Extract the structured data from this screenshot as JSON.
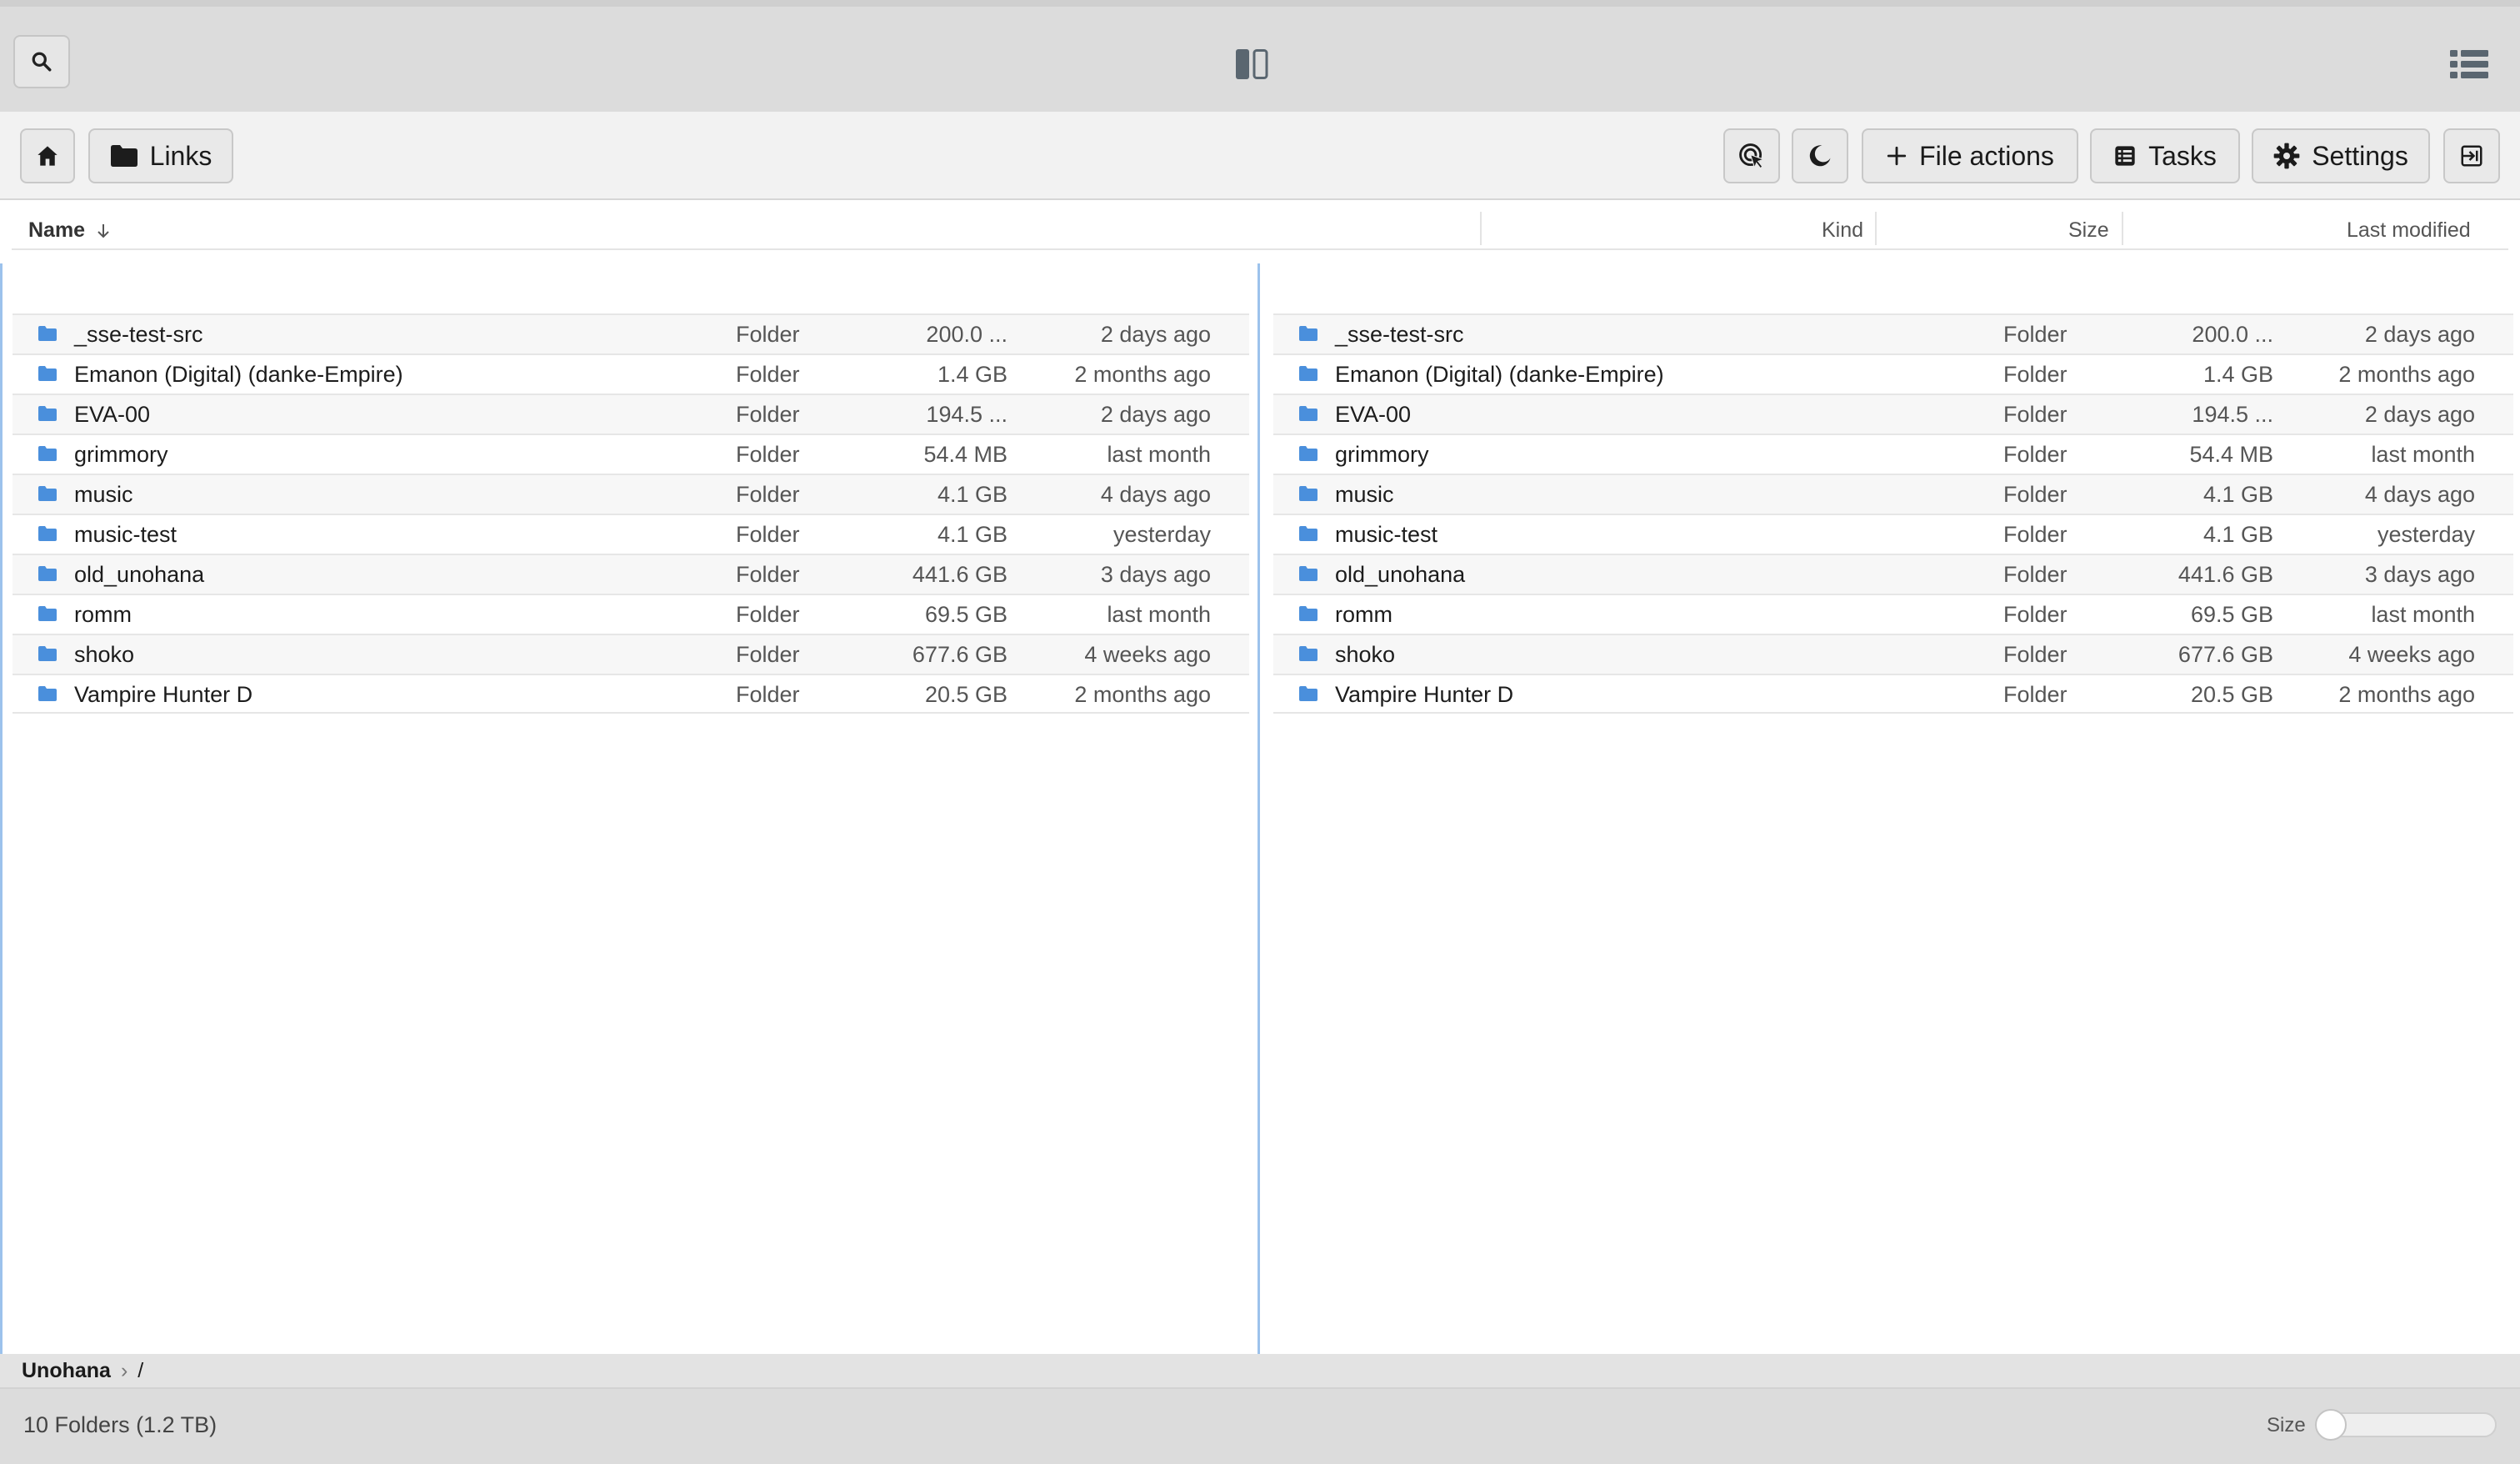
{
  "toolbar": {
    "links_label": "Links",
    "file_actions_label": "File actions",
    "tasks_label": "Tasks",
    "settings_label": "Settings"
  },
  "columns": {
    "name": "Name",
    "kind": "Kind",
    "size": "Size",
    "modified": "Last modified"
  },
  "files": [
    {
      "name": "_sse-test-src",
      "kind": "Folder",
      "size": "200.0 ...",
      "modified": "2 days ago"
    },
    {
      "name": "Emanon (Digital) (danke-Empire)",
      "kind": "Folder",
      "size": "1.4 GB",
      "modified": "2 months ago"
    },
    {
      "name": "EVA-00",
      "kind": "Folder",
      "size": "194.5 ...",
      "modified": "2 days ago"
    },
    {
      "name": "grimmory",
      "kind": "Folder",
      "size": "54.4 MB",
      "modified": "last month"
    },
    {
      "name": "music",
      "kind": "Folder",
      "size": "4.1 GB",
      "modified": "4 days ago"
    },
    {
      "name": "music-test",
      "kind": "Folder",
      "size": "4.1 GB",
      "modified": "yesterday"
    },
    {
      "name": "old_unohana",
      "kind": "Folder",
      "size": "441.6 GB",
      "modified": "3 days ago"
    },
    {
      "name": "romm",
      "kind": "Folder",
      "size": "69.5 GB",
      "modified": "last month"
    },
    {
      "name": "shoko",
      "kind": "Folder",
      "size": "677.6 GB",
      "modified": "4 weeks ago"
    },
    {
      "name": "Vampire Hunter D",
      "kind": "Folder",
      "size": "20.5 GB",
      "modified": "2 months ago"
    }
  ],
  "breadcrumb": {
    "root": "Unohana",
    "separator": "›",
    "path": "/"
  },
  "status": {
    "summary": "10 Folders (1.2 TB)",
    "size_label": "Size",
    "size_slider_value": 0
  },
  "colors": {
    "folder": "#4a8fdc",
    "pane_divider": "#9cc2ec"
  },
  "icons": [
    "search-icon",
    "split-view-icon",
    "list-view-icon",
    "home-icon",
    "folder-icon",
    "cursor-click-icon",
    "moon-icon",
    "plus-icon",
    "tasks-icon",
    "gear-icon",
    "logout-icon"
  ]
}
